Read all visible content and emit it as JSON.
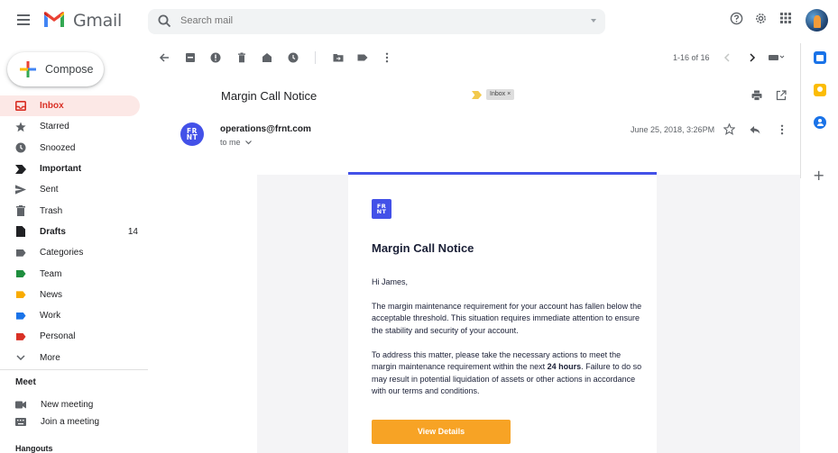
{
  "header": {
    "app_name": "Gmail",
    "search_placeholder": "Search mail"
  },
  "sidebar": {
    "compose_label": "Compose",
    "items": [
      {
        "label": "Inbox",
        "icon": "inbox-icon",
        "count": ""
      },
      {
        "label": "Starred",
        "icon": "star-icon",
        "count": ""
      },
      {
        "label": "Snoozed",
        "icon": "clock-icon",
        "count": ""
      },
      {
        "label": "Important",
        "icon": "important-icon",
        "count": ""
      },
      {
        "label": "Sent",
        "icon": "send-icon",
        "count": ""
      },
      {
        "label": "Trash",
        "icon": "trash-icon",
        "count": ""
      },
      {
        "label": "Drafts",
        "icon": "draft-icon",
        "count": "14"
      },
      {
        "label": "Categories",
        "icon": "label-icon",
        "count": ""
      },
      {
        "label": "Team",
        "icon": "label-icon",
        "count": ""
      },
      {
        "label": "News",
        "icon": "label-icon",
        "count": ""
      },
      {
        "label": "Work",
        "icon": "label-icon",
        "count": ""
      },
      {
        "label": "Personal",
        "icon": "label-icon",
        "count": ""
      },
      {
        "label": "More",
        "icon": "chevron-down-icon",
        "count": ""
      }
    ],
    "label_colors": {
      "categories": "#5f6368",
      "team": "#1e8e3e",
      "news": "#f9ab00",
      "work": "#1a73e8",
      "personal": "#d93025"
    },
    "meet": {
      "title": "Meet",
      "new_meeting": "New meeting",
      "join_meeting": "Join a meeting"
    },
    "hangouts_title": "Hangouts"
  },
  "toolbar": {
    "pager": "1-16 of 16"
  },
  "message": {
    "subject": "Margin Call Notice",
    "label_chip": "Inbox ×",
    "sender": "operations@frnt.com",
    "avatar_line1": "FR",
    "avatar_line2": "NT",
    "to": "to me",
    "date": "June 25, 2018, 3:26PM"
  },
  "email": {
    "logo_line1": "FR",
    "logo_line2": "NT",
    "title": "Margin Call Notice",
    "greeting": "Hi James,",
    "para1": "The margin maintenance requirement for your account has fallen below the acceptable threshold. This situation requires immediate attention to ensure the stability and security of your account.",
    "para2_before": "To address this matter, please take the necessary actions to meet the margin maintenance requirement within the next ",
    "para2_bold": "24 hours",
    "para2_after": ". Failure to do so may result in potential liquidation of assets or other actions in accordance with our terms and conditions.",
    "button_label": "View Details",
    "accent_color": "#4351e8",
    "button_color": "#f7a325"
  }
}
